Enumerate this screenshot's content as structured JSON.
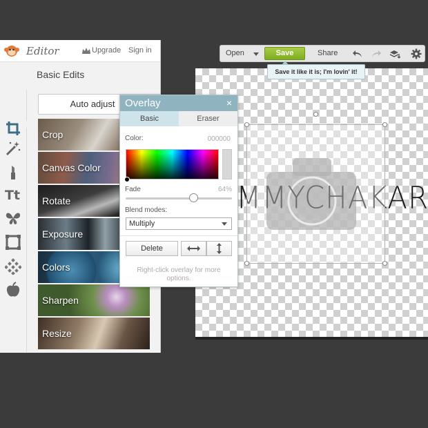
{
  "editor": {
    "app_name": "Editor",
    "upgrade_label": "Upgrade",
    "signin_label": "Sign in",
    "section_title": "Basic Edits",
    "auto_adjust_label": "Auto adjust",
    "tools": [
      {
        "label": "Crop"
      },
      {
        "label": "Canvas Color"
      },
      {
        "label": "Rotate"
      },
      {
        "label": "Exposure"
      },
      {
        "label": "Colors"
      },
      {
        "label": "Sharpen"
      },
      {
        "label": "Resize"
      }
    ],
    "rail_icons": [
      "crop-icon",
      "magic-wand-icon",
      "lipstick-icon",
      "text-icon",
      "butterfly-icon",
      "frame-icon",
      "texture-icon",
      "apple-icon"
    ]
  },
  "toolbar": {
    "open_label": "Open",
    "save_label": "Save",
    "share_label": "Share",
    "tooltip": "Save it like it is;  I'm lovin' it!"
  },
  "overlay": {
    "title": "Overlay",
    "close_glyph": "×",
    "tab_basic": "Basic",
    "tab_eraser": "Eraser",
    "color_label": "Color:",
    "color_value": "000000",
    "fade_label": "Fade",
    "fade_value": "64%",
    "fade_level": 0.64,
    "blend_label": "Blend modes:",
    "blend_value": "Multiply",
    "delete_label": "Delete",
    "hint": "Right-click overlay for more options."
  },
  "canvas": {
    "watermark_text": "MMYCHAKAR"
  },
  "colors": {
    "save_green": "#8ab92d",
    "overlay_header": "#8fb4c0",
    "tab_active": "#cfe3ea"
  }
}
